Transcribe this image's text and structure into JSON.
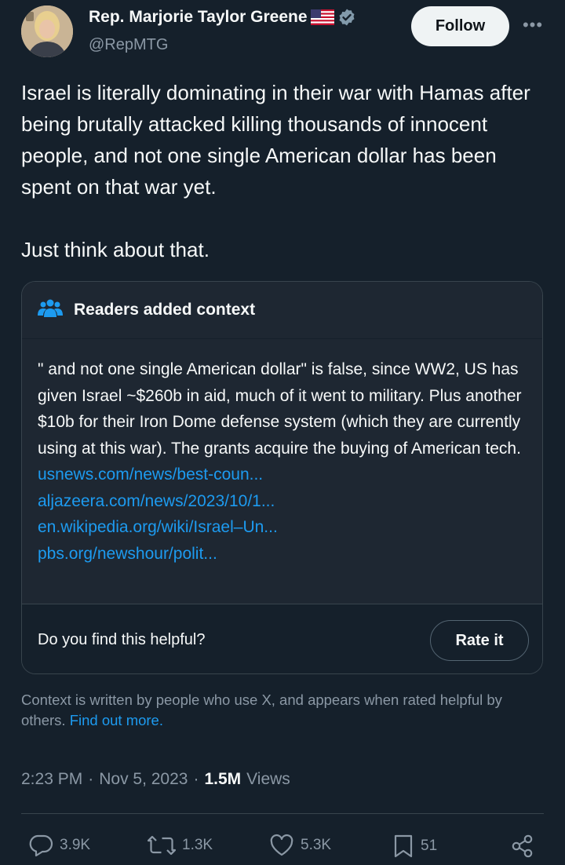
{
  "author": {
    "name": "Rep. Marjorie Taylor Greene",
    "handle": "@RepMTG",
    "flag_icon": "us-flag-icon",
    "verified_icon": "verified-badge-icon",
    "verified_color": "#829aab"
  },
  "header": {
    "follow_label": "Follow",
    "more_label": "•••"
  },
  "tweet": {
    "text": "Israel is literally dominating in their war with Hamas after being brutally attacked killing thousands of innocent people, and not one single American dollar has been spent on that war yet.\n\nJust think about that."
  },
  "community_note": {
    "title": "Readers added context",
    "icon": "people-icon",
    "body": "\" and not one single American dollar\" is false, since WW2, US has given Israel ~$260b in aid, much of it went to military. Plus another $10b for their Iron Dome defense system (which they are currently using at this war). The grants acquire the buying of American tech.",
    "links": [
      "usnews.com/news/best-coun...",
      "aljazeera.com/news/2023/10/1...",
      "en.wikipedia.org/wiki/Israel–Un...",
      "pbs.org/newshour/polit..."
    ],
    "helpful_prompt": "Do you find this helpful?",
    "rate_label": "Rate it"
  },
  "context_footer": {
    "text": "Context is written by people who use X, and appears when rated helpful by others.",
    "link": "Find out more."
  },
  "meta": {
    "time": "2:23 PM",
    "separator": "·",
    "date": "Nov 5, 2023",
    "views_count": "1.5M",
    "views_label": "Views"
  },
  "actions": {
    "replies": "3.9K",
    "reposts": "1.3K",
    "likes": "5.3K",
    "bookmarks": "51"
  },
  "colors": {
    "background": "#15202b",
    "accent": "#1d9bf0",
    "muted": "#8b98a5",
    "note_background": "#1e2732"
  }
}
